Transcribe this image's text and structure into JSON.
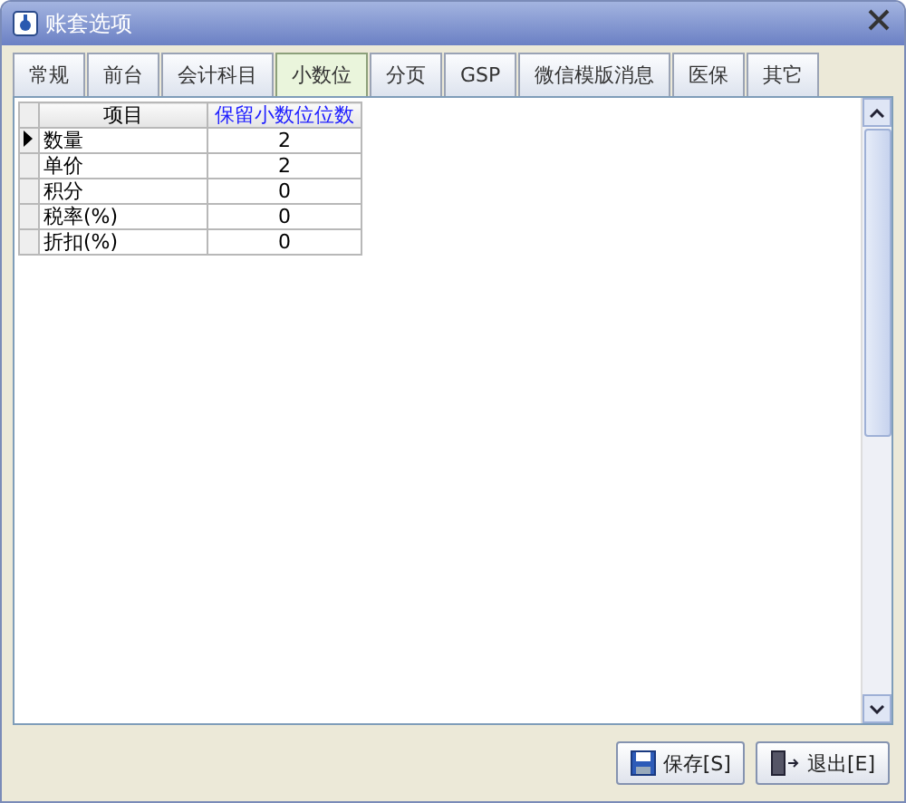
{
  "window": {
    "title": "账套选项"
  },
  "tabs": [
    {
      "label": "常规",
      "selected": false
    },
    {
      "label": "前台",
      "selected": false
    },
    {
      "label": "会计科目",
      "selected": false
    },
    {
      "label": "小数位",
      "selected": true
    },
    {
      "label": "分页",
      "selected": false
    },
    {
      "label": "GSP",
      "selected": false
    },
    {
      "label": "微信模版消息",
      "selected": false
    },
    {
      "label": "医保",
      "selected": false
    },
    {
      "label": "其它",
      "selected": false
    }
  ],
  "table": {
    "columns": [
      "项目",
      "保留小数位位数"
    ],
    "rows": [
      {
        "item": "数量",
        "digits": "2",
        "current": true
      },
      {
        "item": "单价",
        "digits": "2",
        "current": false
      },
      {
        "item": "积分",
        "digits": "0",
        "current": false
      },
      {
        "item": "税率(%)",
        "digits": "0",
        "current": false
      },
      {
        "item": "折扣(%)",
        "digits": "0",
        "current": false
      }
    ]
  },
  "buttons": [
    {
      "kind": "save",
      "label": "保存[S]"
    },
    {
      "kind": "exit",
      "label": "退出[E]"
    }
  ]
}
